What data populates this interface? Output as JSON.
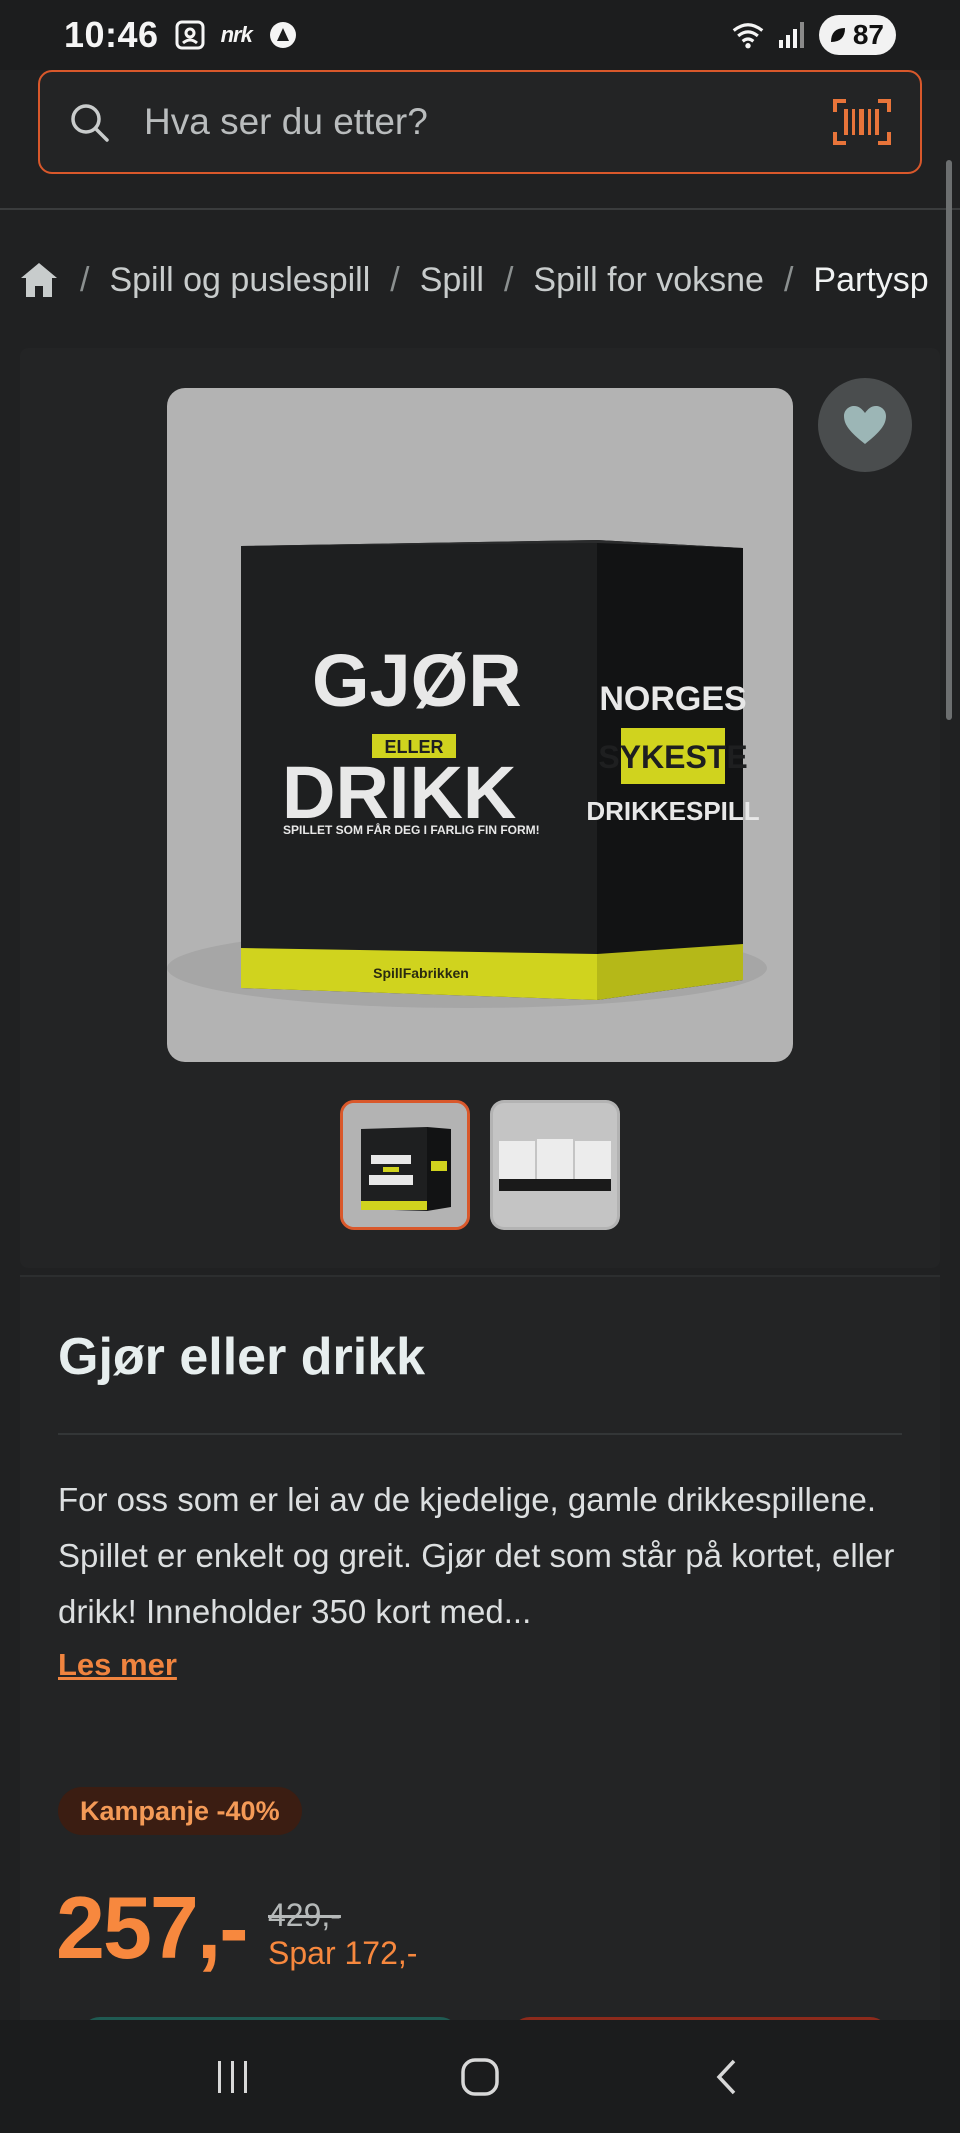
{
  "status_bar": {
    "time": "10:46",
    "nrk_label": "nrk",
    "battery": "87"
  },
  "search": {
    "placeholder": "Hva ser du etter?",
    "accent_color": "#d9582b"
  },
  "breadcrumb": {
    "items": [
      "Spill og puslespill",
      "Spill",
      "Spill for voksne",
      "Partysp"
    ]
  },
  "product": {
    "image_alt": "Gjør eller drikk spillboks",
    "box_front": {
      "line1": "GJØR",
      "line2": "ELLER",
      "line3": "DRIKK",
      "tagline": "SPILLET SOM FÅR DEG I FARLIG FIN FORM!",
      "brand": "SpillFabrikken"
    },
    "box_side": {
      "line1": "NORGES",
      "line2": "SYKESTE",
      "line3": "DRIKKESPILL"
    },
    "thumbnails": [
      "Bilde 1",
      "Bilde 2"
    ],
    "title": "Gjør eller drikk",
    "description": "For oss som er lei av de kjedelige, gamle drikkespillene. Spillet er enkelt og greit. Gjør det som står på kortet, eller drikk! Inneholder 350 kort med...",
    "read_more": "Les mer",
    "badge": "Kampanje -40%",
    "price": "257,-",
    "old_price": "429,-",
    "savings": "Spar 172,-"
  },
  "colors": {
    "accent": "#f7883e",
    "badge_bg": "#3b1d12",
    "page_bg": "#202122"
  }
}
